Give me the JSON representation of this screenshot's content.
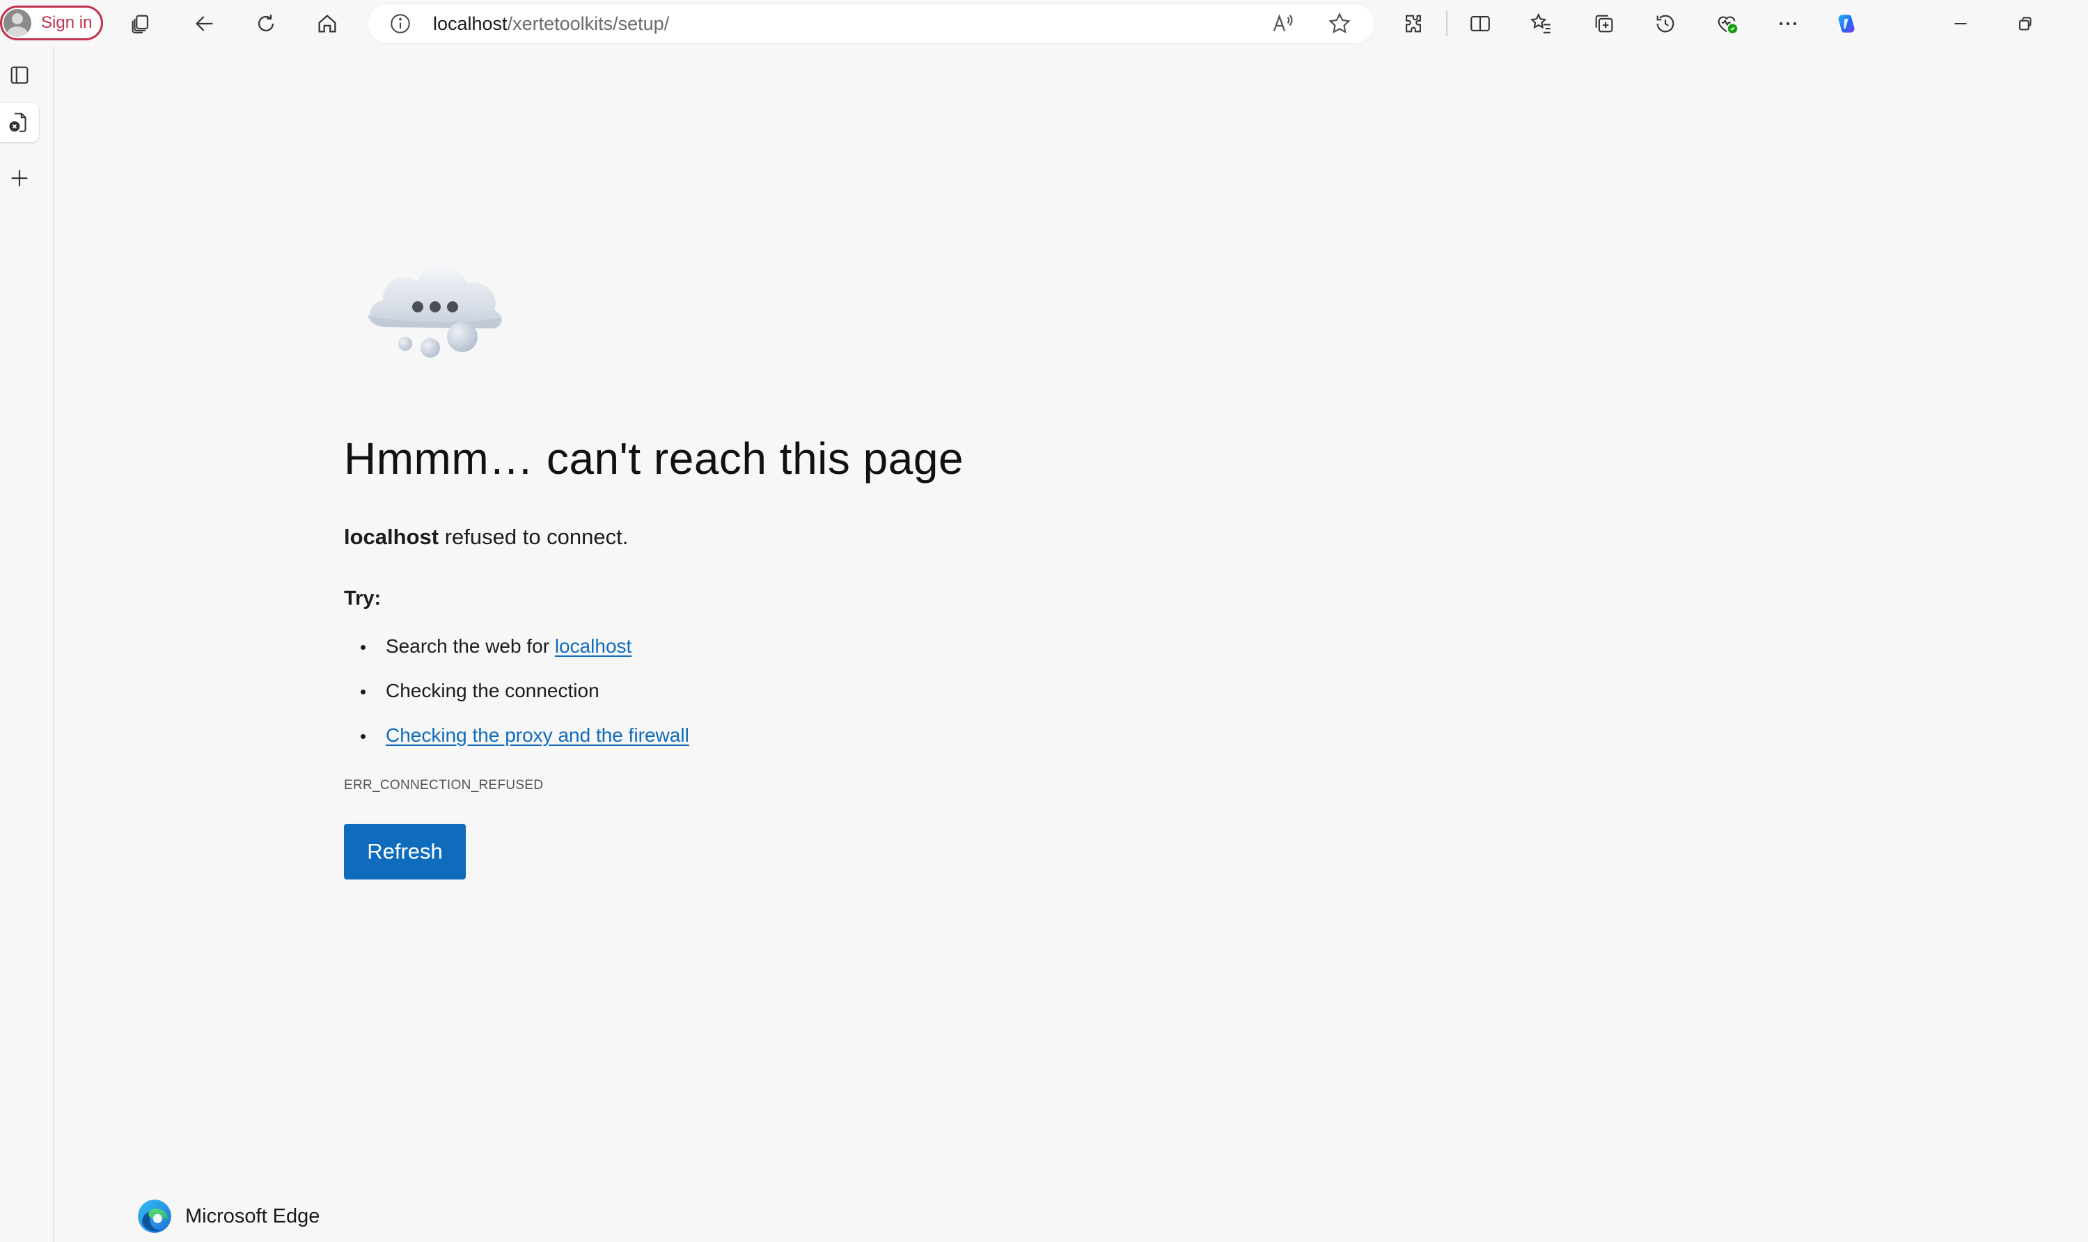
{
  "toolbar": {
    "signin_label": "Sign in",
    "icons": [
      "workspaces-icon",
      "back-icon",
      "refresh-icon",
      "home-icon",
      "info-icon",
      "read-aloud-icon",
      "favorite-star-icon",
      "extensions-icon",
      "split-screen-icon",
      "favorites-icon",
      "collections-icon",
      "history-icon",
      "browser-essentials-icon",
      "more-icon",
      "copilot-icon",
      "minimize-icon",
      "restore-icon"
    ]
  },
  "address": {
    "host": "localhost",
    "path": "/xertetoolkits/setup/"
  },
  "error": {
    "headline": "Hmmm… can't reach this page",
    "host": "localhost",
    "refused_suffix": " refused to connect.",
    "try_label": "Try:",
    "tips": [
      {
        "prefix": "Search the web for ",
        "link": "localhost"
      },
      {
        "text": "Checking the connection"
      },
      {
        "link": "Checking the proxy and the firewall"
      }
    ],
    "code": "ERR_CONNECTION_REFUSED",
    "refresh_label": "Refresh"
  },
  "footer": {
    "brand": "Microsoft Edge"
  },
  "colors": {
    "accent": "#0f6cbd",
    "signin": "#c4314b",
    "background": "#f7f7f7"
  }
}
